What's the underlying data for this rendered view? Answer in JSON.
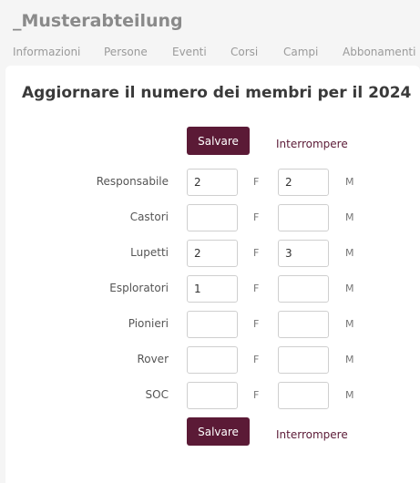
{
  "background": {
    "title": "_Musterabteilung",
    "nav": [
      "Informazioni",
      "Persone",
      "Eventi",
      "Corsi",
      "Campi",
      "Abbonamenti"
    ]
  },
  "modal": {
    "title": "Aggiornare il numero dei membri per il 2024",
    "save_label": "Salvare",
    "cancel_label": "Interrompere",
    "female_unit": "F",
    "male_unit": "M",
    "rows": [
      {
        "label": "Responsabile",
        "f": "2",
        "m": "2"
      },
      {
        "label": "Castori",
        "f": "",
        "m": ""
      },
      {
        "label": "Lupetti",
        "f": "2",
        "m": "3"
      },
      {
        "label": "Esploratori",
        "f": "1",
        "m": ""
      },
      {
        "label": "Pionieri",
        "f": "",
        "m": ""
      },
      {
        "label": "Rover",
        "f": "",
        "m": ""
      },
      {
        "label": "SOC",
        "f": "",
        "m": ""
      }
    ]
  },
  "colors": {
    "accent": "#5b1a36"
  }
}
